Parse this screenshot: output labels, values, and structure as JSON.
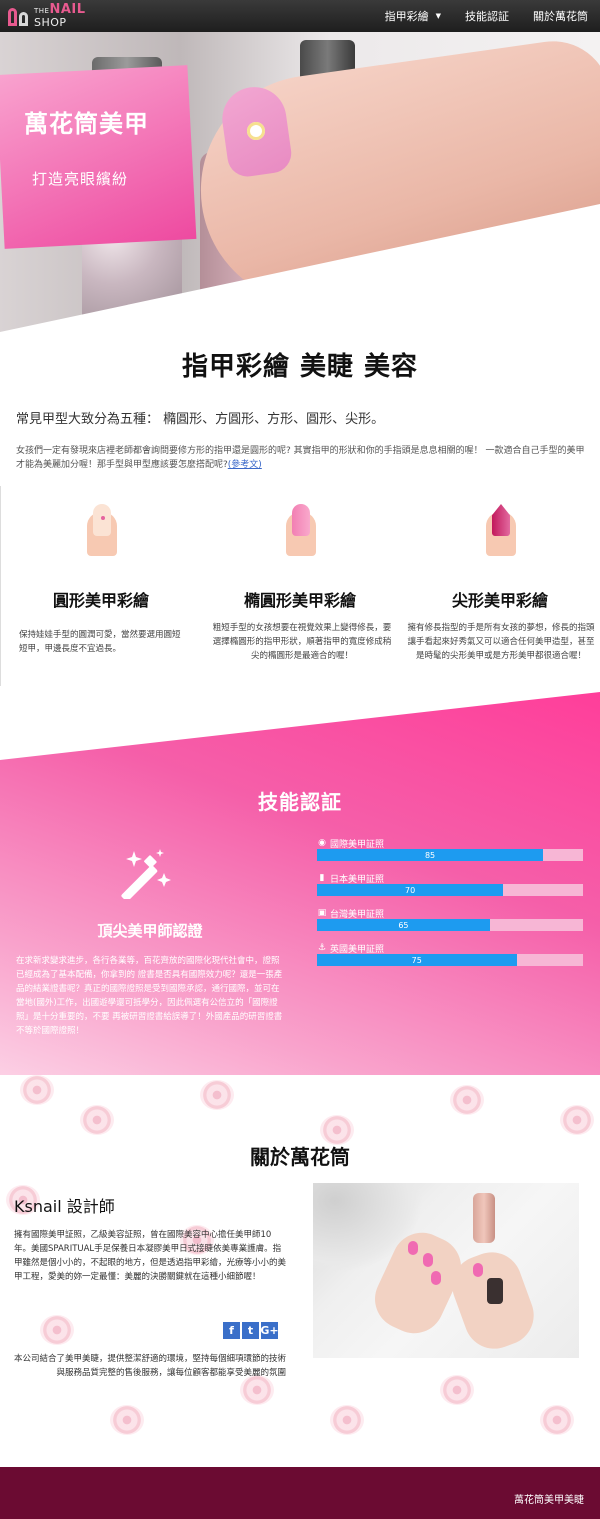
{
  "brand": {
    "the": "THE",
    "nail": "NAIL",
    "shop": "SHOP"
  },
  "nav": {
    "items": [
      "指甲彩繪",
      "技能認証",
      "關於萬花筒"
    ]
  },
  "hero": {
    "title": "萬花筒美甲",
    "subtitle": "打造亮眼繽紛"
  },
  "intro": {
    "heading": "指甲彩繪 美睫 美容",
    "lead": "常見甲型大致分為五種： 橢圓形、方圓形、方形、圓形、尖形。",
    "body": "女孩們一定有發現來店裡老師都會詢問要修方形的指甲還是圓形的呢? 其實指甲的形狀和你的手指頭是息息相關的喔！ 一款適合自己手型的美甲才能為美麗加分喔！那手型與甲型應該要怎麼搭配呢?",
    "ref": "(參考文)"
  },
  "shapes": [
    {
      "title": "圓形美甲彩繪",
      "text": "保持娃娃手型的圓潤可愛，當然要選用圓短短甲，甲邊長度不宜過長。"
    },
    {
      "title": "橢圓形美甲彩繪",
      "text": "粗短手型的女孩想要在視覺效果上變得修長，要選擇橢圓形的指甲形狀，順著指甲的寬度修成稍尖的橢圓形是最適合的喔！"
    },
    {
      "title": "尖形美甲彩繪",
      "text": "擁有修長指型的手是所有女孩的夢想，修長的指頭讓手看起來好秀氣又可以適合任何美甲造型，甚至是時髦的尖形美甲或是方形美甲都很適合喔！"
    }
  ],
  "skills": {
    "title": "技能認証",
    "subtitle": "頂尖美甲師認證",
    "text": "在求新求變求進步，各行各業等，百花齊放的國際化現代社會中，證照已經成為了基本配備，你拿到的 證書是否具有國際效力呢？還是一張產品的結業證書呢？真正的國際證照是受到國際承認，通行國際，並可在當地(國外)工作，出國遊學還可抵學分，因此佩選有公信立的「國際證照」是十分重要的，不要 再被研習證書給誤導了！外國產品的研習證書不等於國際證照！",
    "bars": [
      {
        "icon": "globe",
        "label": "國際美甲証照",
        "value": 85
      },
      {
        "icon": "bookmark",
        "label": "日本美甲証照",
        "value": 70
      },
      {
        "icon": "badge",
        "label": "台灣美甲証照",
        "value": 65
      },
      {
        "icon": "anchor",
        "label": "英國美甲証照",
        "value": 75
      }
    ]
  },
  "about": {
    "title": "關於萬花筒",
    "designer": "Ksnail 設計師",
    "text": "擁有國際美甲証照，乙級美容証照，曾在國際美容中心擔任美甲師10年。美國SPARITUAL手足保養日本凝膠美甲日式接睫依美專業護膚。指甲雖然是個小小的，不起眼的地方，但是透過指甲彩繪，光療等小小的美甲工程，愛美的妳一定最懂：美麗的決勝關鍵就在這種小細節喔！",
    "social": [
      "f",
      "t",
      "G+"
    ],
    "text2": "本公司結合了美甲美睫，提供整潔舒適的環境，堅持每個細項環節的技術與服務品質完整的售後服務，讓每位顧客都能享受美麗的氛圍"
  },
  "footer": {
    "text": "萬花筒美甲美睫"
  }
}
